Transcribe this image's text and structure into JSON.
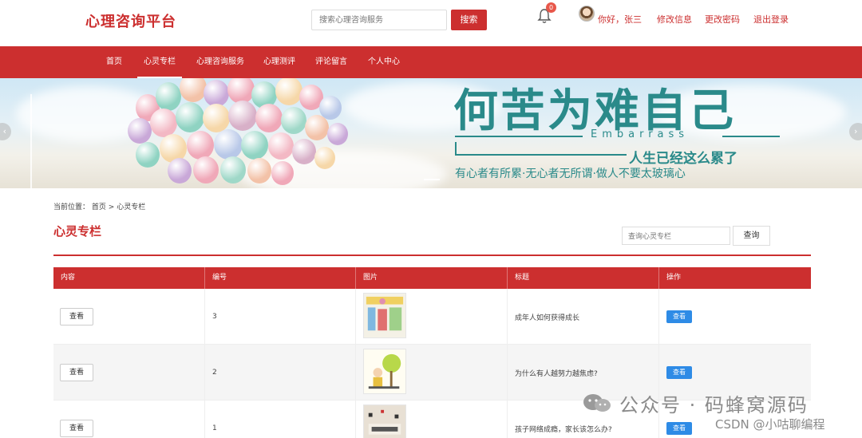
{
  "header": {
    "logo": "心理咨询平台",
    "search_placeholder": "搜索心理咨询服务",
    "search_button": "搜索",
    "notification_count": "0",
    "greeting": "你好，张三",
    "links": [
      "修改信息",
      "更改密码",
      "退出登录"
    ]
  },
  "nav": {
    "items": [
      "首页",
      "心灵专栏",
      "心理咨询服务",
      "心理测评",
      "评论留言",
      "个人中心"
    ],
    "active": "心灵专栏"
  },
  "banner": {
    "title": "何苦为难自己",
    "english": "Embarrass",
    "subtitle": "人生已经这么累了",
    "slogan": "有心者有所累·无心者无所谓·做人不要太玻璃心"
  },
  "breadcrumb": {
    "prefix": "当前位置：",
    "home": "首页",
    "sep": ">",
    "current": "心灵专栏"
  },
  "section": {
    "title": "心灵专栏",
    "search_placeholder": "查询心灵专栏",
    "search_button": "查询"
  },
  "table": {
    "headers": [
      "内容",
      "编号",
      "图片",
      "标题",
      "操作"
    ],
    "rows": [
      {
        "content_button": "查看",
        "number": "3",
        "title": "成年人如何获得成长",
        "action": "查看"
      },
      {
        "content_button": "查看",
        "number": "2",
        "title": "为什么有人越努力越焦虑?",
        "action": "查看"
      },
      {
        "content_button": "查看",
        "number": "1",
        "title": "孩子网络成瘾，家长该怎么办?",
        "action": "查看"
      }
    ]
  },
  "watermark": {
    "text": "公众号 · 码蜂窝源码",
    "csdn": "CSDN @小咕聊编程"
  },
  "colors": {
    "primary": "#cc2f2f",
    "action_blue": "#2e8be6",
    "banner_teal": "#2a8a8a"
  }
}
